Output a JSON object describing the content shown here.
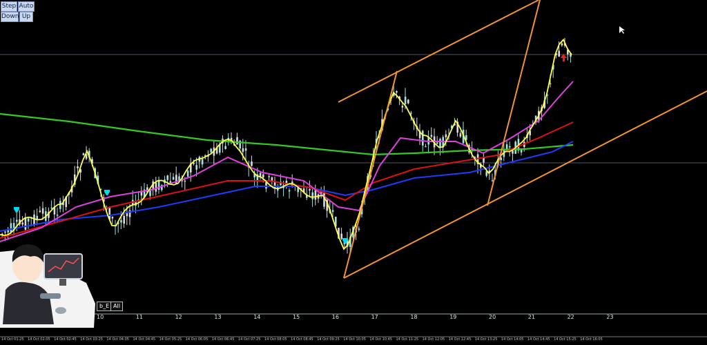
{
  "toolbar": {
    "step_label": "Step",
    "auto_label": "Auto",
    "down_label": "Down",
    "up_label": "Up"
  },
  "tags": {
    "left_label": "b_E",
    "all_label": "All"
  },
  "hour_labels": [
    "10",
    "11",
    "12",
    "13",
    "14",
    "15",
    "16",
    "17",
    "18",
    "19",
    "20",
    "21",
    "22",
    "23"
  ],
  "time_labels": [
    "14 Oct 01:25",
    "14 Oct 02:05",
    "14 Oct 02:45",
    "14 Oct 03:25",
    "14 Oct 04:05",
    "14 Oct 04:45",
    "14 Oct 05:25",
    "14 Oct 06:05",
    "14 Oct 06:45",
    "14 Oct 07:25",
    "14 Oct 08:05",
    "14 Oct 08:45",
    "14 Oct 09:25",
    "14 Oct 10:05",
    "14 Oct 10:45",
    "14 Oct 11:25",
    "14 Oct 12:05",
    "14 Oct 12:45",
    "14 Oct 13:25",
    "14 Oct 14:05",
    "14 Oct 14:45",
    "14 Oct 15:25",
    "14 Oct 16:05"
  ],
  "colors": {
    "background": "#000000",
    "bull_candle": "#9fe3e3",
    "bear_candle": "#dcdcdc",
    "ma_fast": "#ffff4a",
    "ma_magenta": "#e040e0",
    "ma_red": "#dd1111",
    "ma_blue": "#1c3cff",
    "ma_slow_green": "#33cc22",
    "channel_orange": "#f39530",
    "cyan_arrows": "#00d8f0",
    "red_arrow": "#ff1a1a",
    "grid_line": "#4a5660"
  }
}
